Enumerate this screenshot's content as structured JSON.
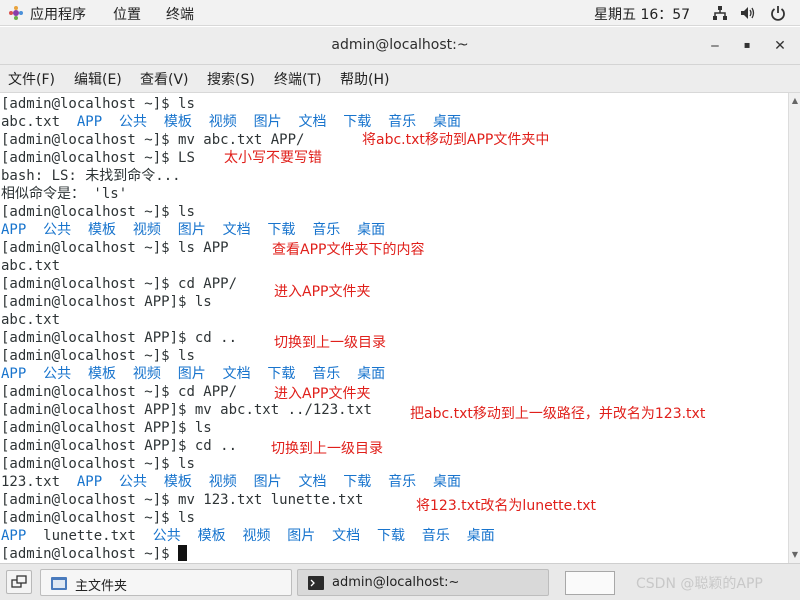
{
  "top_panel": {
    "applications": "应用程序",
    "places": "位置",
    "terminal_app": "终端",
    "clock": "星期五 16：57",
    "icons": [
      "applications-icon",
      "network-icon",
      "volume-icon",
      "power-icon"
    ]
  },
  "window": {
    "title": "admin@localhost:~",
    "minimize": "‒",
    "maximize": "▪",
    "close": "✕"
  },
  "menubar": {
    "file": "文件(F)",
    "edit": "编辑(E)",
    "view": "查看(V)",
    "search": "搜索(S)",
    "terminal": "终端(T)",
    "help": "帮助(H)"
  },
  "terminal": {
    "lines": [
      {
        "prompt": "[admin@localhost ~]$ ",
        "text": "ls"
      },
      {
        "output": "abc.txt",
        "dirs": "  APP  公共  模板  视频  图片  文档  下载  音乐  桌面"
      },
      {
        "prompt": "[admin@localhost ~]$ ",
        "text": "mv abc.txt APP/"
      },
      {
        "prompt": "[admin@localhost ~]$ ",
        "text": "LS"
      },
      {
        "output": "bash: LS: 未找到命令..."
      },
      {
        "output": "相似命令是： 'ls'"
      },
      {
        "prompt": "[admin@localhost ~]$ ",
        "text": "ls"
      },
      {
        "dirs": "APP  公共  模板  视频  图片  文档  下载  音乐  桌面"
      },
      {
        "prompt": "[admin@localhost ~]$ ",
        "text": "ls APP"
      },
      {
        "output": "abc.txt"
      },
      {
        "prompt": "[admin@localhost ~]$ ",
        "text": "cd APP/"
      },
      {
        "prompt": "[admin@localhost APP]$ ",
        "text": "ls"
      },
      {
        "output": "abc.txt"
      },
      {
        "prompt": "[admin@localhost APP]$ ",
        "text": "cd .."
      },
      {
        "prompt": "[admin@localhost ~]$ ",
        "text": "ls"
      },
      {
        "dirs": "APP  公共  模板  视频  图片  文档  下载  音乐  桌面"
      },
      {
        "prompt": "[admin@localhost ~]$ ",
        "text": "cd APP/"
      },
      {
        "prompt": "[admin@localhost APP]$ ",
        "text": "mv abc.txt ../123.txt"
      },
      {
        "prompt": "[admin@localhost APP]$ ",
        "text": "ls"
      },
      {
        "prompt": "[admin@localhost APP]$ ",
        "text": "cd .."
      },
      {
        "prompt": "[admin@localhost ~]$ ",
        "text": "ls"
      },
      {
        "output": "123.txt",
        "dirs": "  APP  公共  模板  视频  图片  文档  下载  音乐  桌面"
      },
      {
        "prompt": "[admin@localhost ~]$ ",
        "text": "mv 123.txt lunette.txt"
      },
      {
        "prompt": "[admin@localhost ~]$ ",
        "text": "ls"
      },
      {
        "dirs_a": "APP",
        "output": "  lunette.txt",
        "dirs": "  公共  模板  视频  图片  文档  下载  音乐  桌面"
      },
      {
        "prompt": "[admin@localhost ~]$ ",
        "text": "",
        "cursor": true
      }
    ],
    "notes": [
      "将abc.txt移动到APP文件夹中",
      "太小写不要写错",
      "查看APP文件夹下的内容",
      "进入APP文件夹",
      "切换到上一级目录",
      "进入APP文件夹",
      "把abc.txt移动到上一级路径，并改名为123.txt",
      "切换到上一级目录",
      "将123.txt改名为lunette.txt"
    ]
  },
  "taskbar": {
    "home_folder": "主文件夹",
    "terminal_task": "admin@localhost:~",
    "watermark": "CSDN @聪颖的APP"
  },
  "colors": {
    "directory_blue": "#1874cd",
    "annotation_red": "#e0201b",
    "text": "#2e3436"
  }
}
